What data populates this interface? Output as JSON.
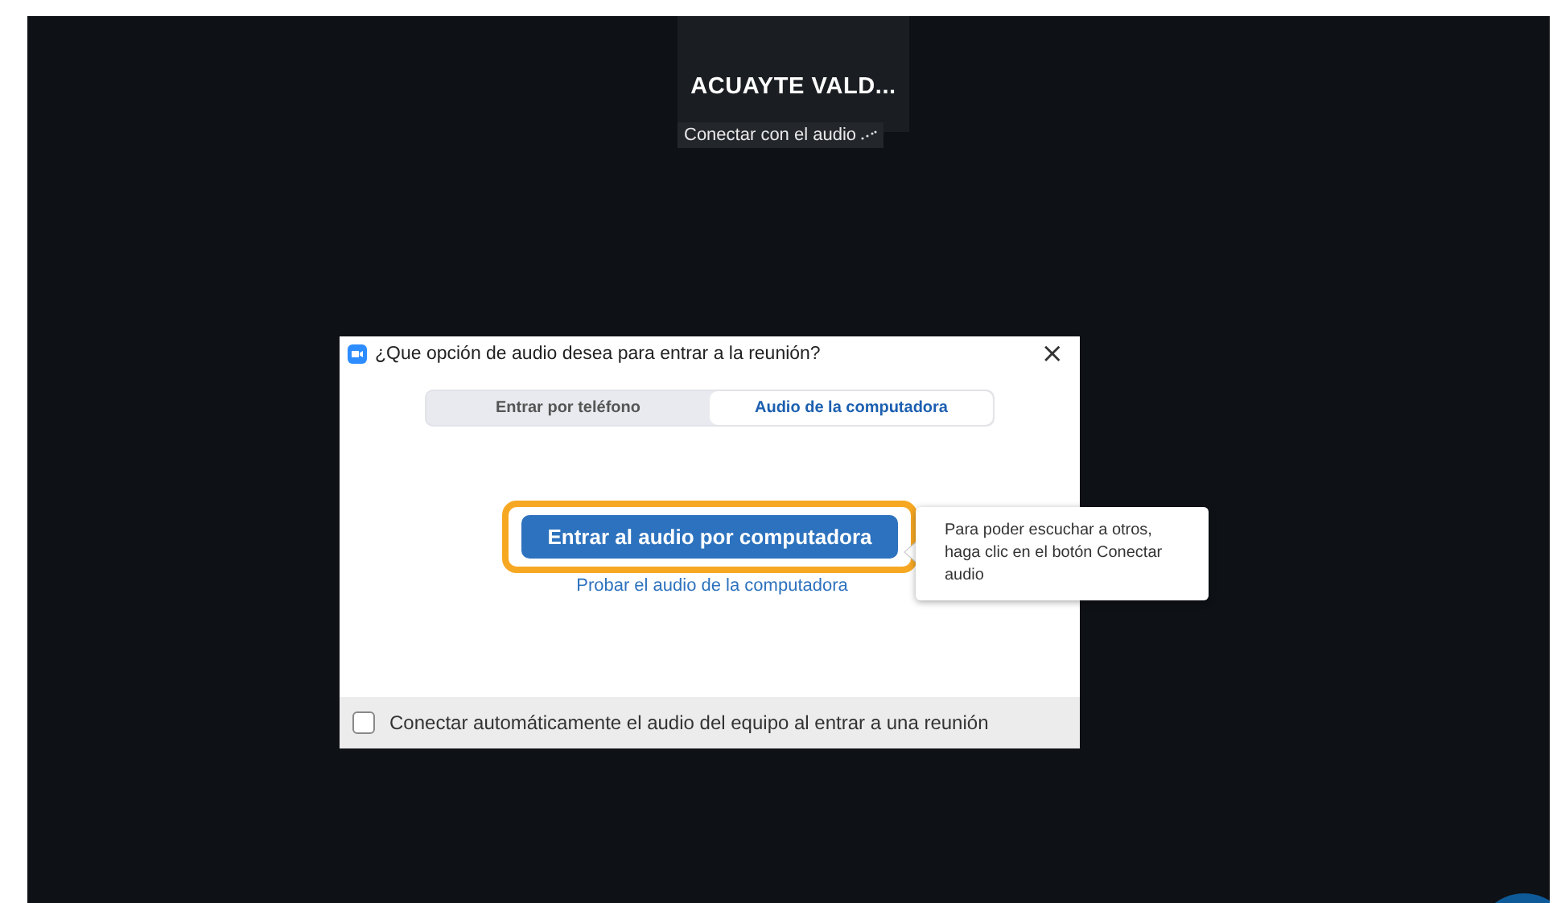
{
  "participant": {
    "name": "ACUAYTE VALD...",
    "status": "Conectar con el audio"
  },
  "dialog": {
    "title": "¿Que opción de audio desea para entrar a la reunión?",
    "close": "×",
    "tabs": [
      {
        "label": "Entrar por teléfono",
        "selected": false
      },
      {
        "label": "Audio de la computadora",
        "selected": true
      }
    ],
    "join_button": {
      "label": "Entrar al audio por computadora",
      "highlighted": true
    },
    "test_link": "Probar el audio de la computadora",
    "tooltip": "Para poder escuchar a otros, haga clic en el botón Conectar audio",
    "auto_connect": {
      "label": "Conectar automáticamente el audio del equipo al entrar a una reunión",
      "checked": false
    }
  }
}
